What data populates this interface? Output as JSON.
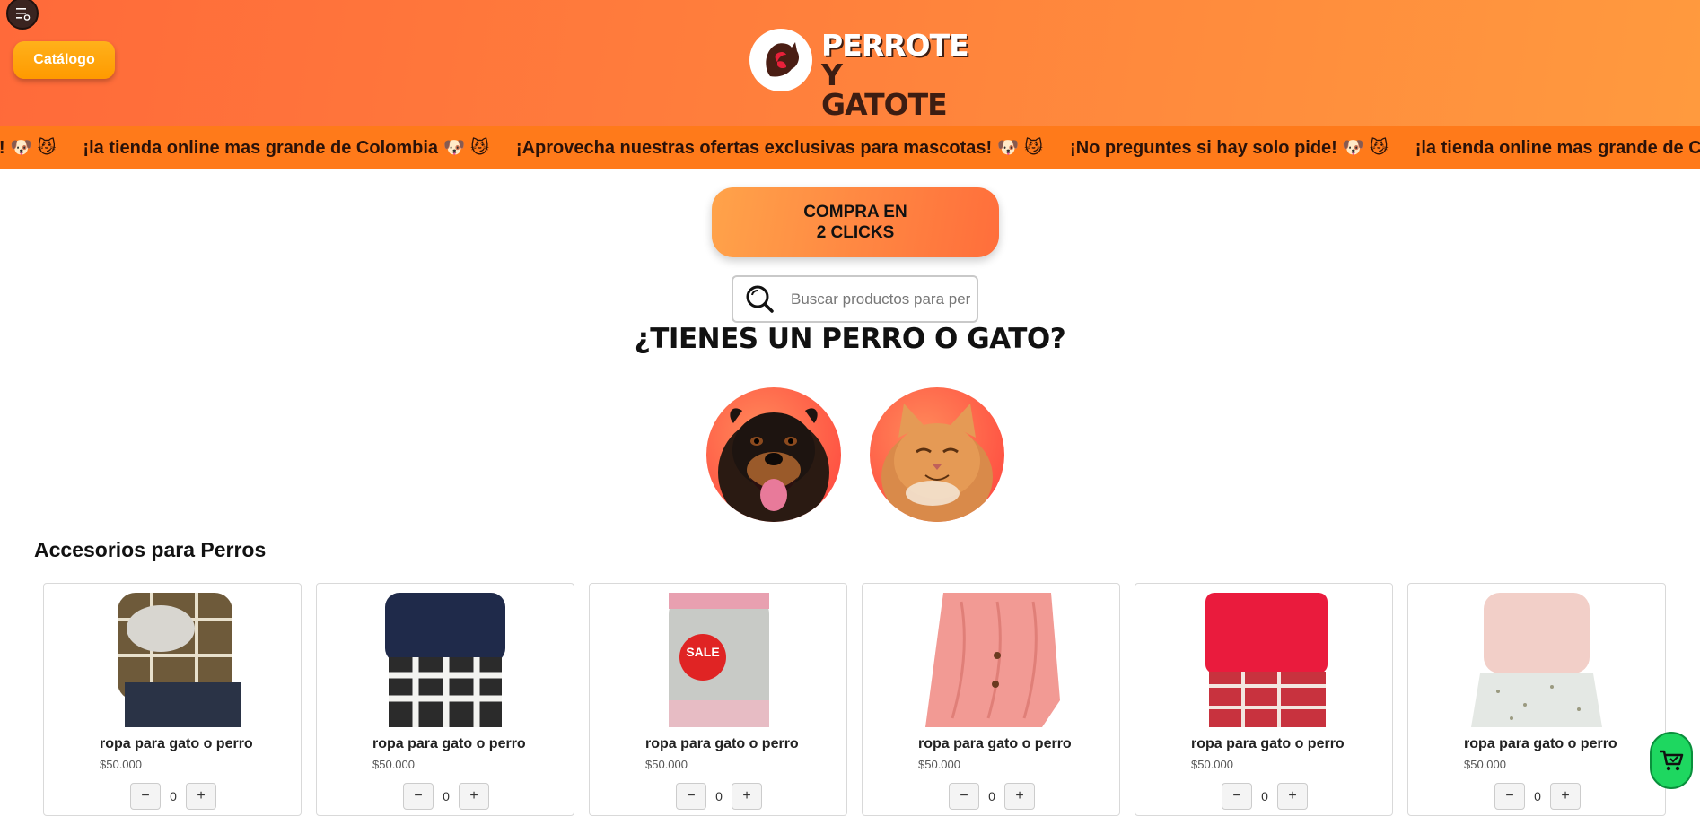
{
  "header": {
    "catalog_label": "Catálogo",
    "logo_line1": "PERROTE",
    "logo_line2": "Y GATOTE"
  },
  "marquee": {
    "items": [
      "ide! 🐶 😼",
      "¡la tienda online mas grande de Colombia 🐶 😼",
      "¡Aprovecha nuestras ofertas exclusivas para mascotas! 🐶 😼",
      "¡No preguntes si hay solo pide! 🐶 😼",
      "¡la tienda online mas grande de Colombia! 🐶 😼"
    ]
  },
  "cta": {
    "line1": "COMPRA EN",
    "line2": "2 CLICKS"
  },
  "search": {
    "placeholder": "Buscar productos para perro"
  },
  "question": "¿TIENES UN PERRO O GATO?",
  "section_title": "Accesorios para Perros",
  "products": [
    {
      "name": "ropa para gato o perro",
      "price": "$50.000",
      "qty": "0",
      "image": "plaid-shirt"
    },
    {
      "name": "ropa para gato o perro",
      "price": "$50.000",
      "qty": "0",
      "image": "navy-plaid-dress"
    },
    {
      "name": "ropa para gato o perro",
      "price": "$50.000",
      "qty": "0",
      "image": "grey-sweater-sale",
      "badge": "SALE"
    },
    {
      "name": "ropa para gato o perro",
      "price": "$50.000",
      "qty": "0",
      "image": "pink-knit-sweater"
    },
    {
      "name": "ropa para gato o perro",
      "price": "$50.000",
      "qty": "0",
      "image": "red-plaid-dress"
    },
    {
      "name": "ropa para gato o perro",
      "price": "$50.000",
      "qty": "0",
      "image": "pink-tulle-dress"
    }
  ],
  "colors": {
    "header_orange": "#ff7f3c",
    "marquee": "#ff7a1a",
    "catalog_button": "#ffa500",
    "cart_green": "#1ed760"
  }
}
